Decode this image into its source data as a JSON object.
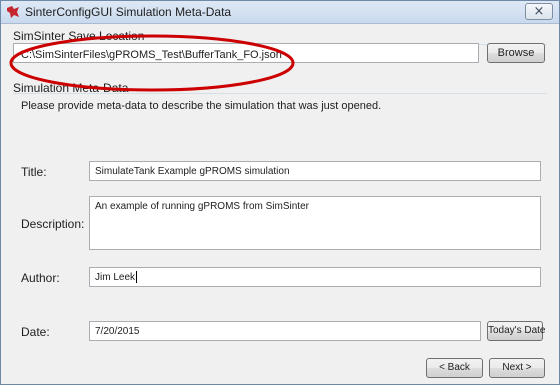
{
  "window": {
    "title": "SinterConfigGUI Simulation Meta-Data",
    "close_symbol": "×",
    "icon": "app-logo-icon",
    "close_icon": "close-icon",
    "accent_color": "#c6262e",
    "annotation_color": "#cc0000"
  },
  "save_location": {
    "group_title": "SimSinter Save Location",
    "path_value": "C:\\SimSinterFiles\\gPROMS_Test\\BufferTank_FO.json",
    "browse_label": "Browse"
  },
  "meta_data": {
    "group_title": "Simulation Meta-Data",
    "instruction": "Please provide meta-data to describe the simulation that was just opened.",
    "title_label": "Title:",
    "title_value": "SimulateTank Example gPROMS simulation",
    "description_label": "Description:",
    "description_value": "An example of running gPROMS from SimSinter",
    "author_label": "Author:",
    "author_value": "Jim Leek",
    "date_label": "Date:",
    "date_value": "7/20/2015",
    "todays_date_label": "Today's Date"
  },
  "navigation": {
    "back_label": "< Back",
    "next_label": "Next >"
  }
}
